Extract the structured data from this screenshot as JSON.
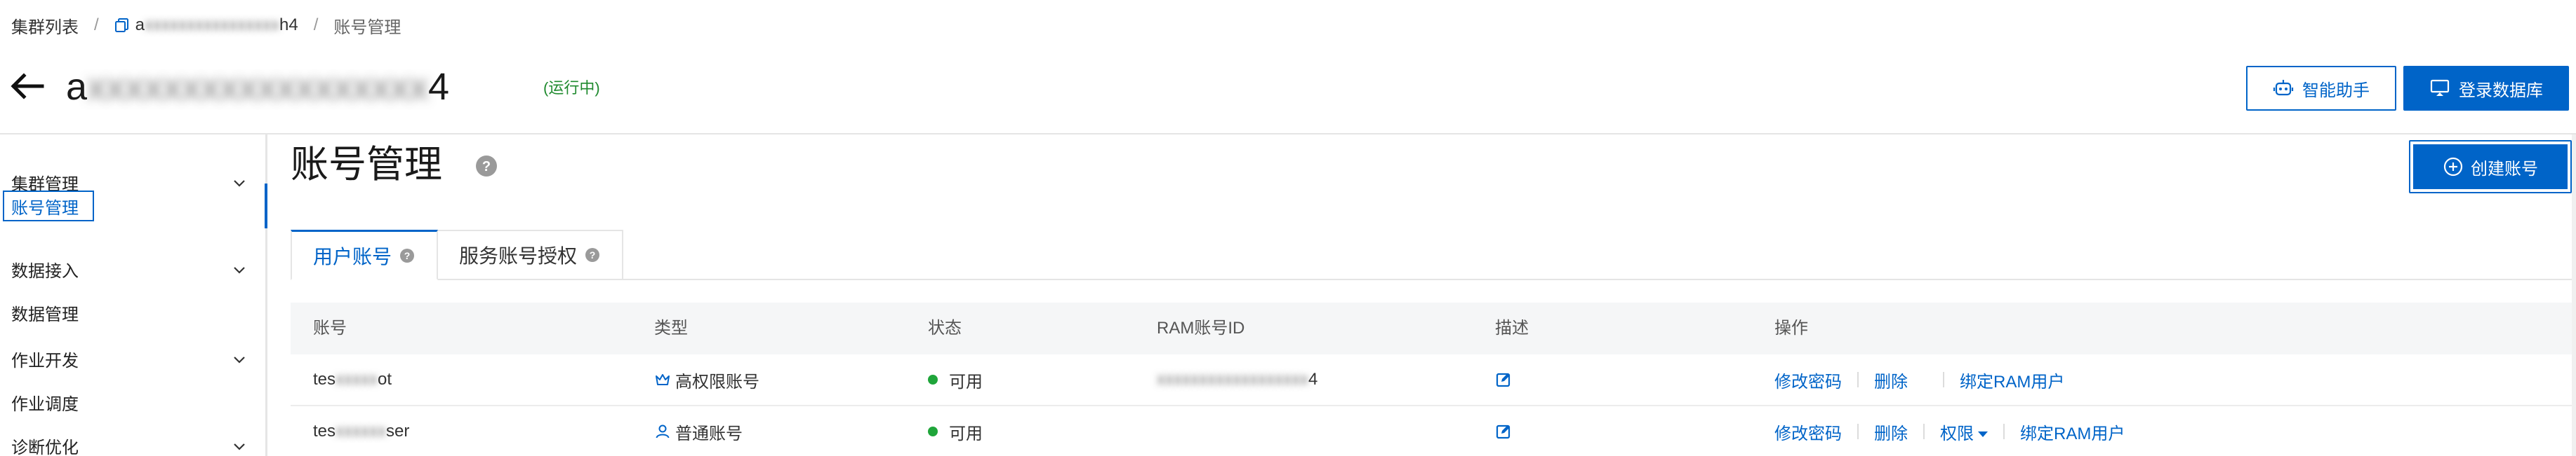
{
  "colors": {
    "accent": "#0064c8",
    "status_running": "#1f8a2e",
    "status_available": "#1fa53a",
    "text": "#333333",
    "header_bg": "#f5f6f7"
  },
  "breadcrumb": {
    "cluster_list": "集群列表",
    "separator": "/",
    "cluster_prefix": "a",
    "cluster_masked": "xxxxxxxxxxxxxxxx",
    "cluster_suffix": "h4",
    "current": "账号管理",
    "cluster_icon": "copy-icon"
  },
  "header": {
    "back_icon": "arrow-left-icon",
    "cluster_prefix": "a",
    "cluster_masked": "xxxxxxxxxxxxxxxxxx",
    "cluster_suffix": "4",
    "status": "(运行中)",
    "assistant_label": "智能助手",
    "assistant_icon": "robot-icon",
    "login_db_label": "登录数据库",
    "login_db_icon": "monitor-icon"
  },
  "sidebar": {
    "items": [
      {
        "label": "集群管理",
        "expandable": true
      },
      {
        "label": "账号管理",
        "active": true
      },
      {
        "label": "数据接入",
        "expandable": true
      },
      {
        "label": "数据管理"
      },
      {
        "label": "作业开发",
        "expandable": true
      },
      {
        "label": "作业调度"
      },
      {
        "label": "诊断优化",
        "expandable": true
      }
    ]
  },
  "main": {
    "title": "账号管理",
    "create_label": "创建账号",
    "tabs": [
      {
        "label": "用户账号",
        "active": true
      },
      {
        "label": "服务账号授权"
      }
    ],
    "table": {
      "columns": [
        "账号",
        "类型",
        "状态",
        "RAM账号ID",
        "描述",
        "操作"
      ],
      "rows": [
        {
          "account_prefix": "tes",
          "account_masked": "xxxxx",
          "account_suffix": "ot",
          "type": "高权限账号",
          "type_icon": "crown-icon",
          "status": "可用",
          "ram_masked": "xxxxxxxxxxxxxxxxxx",
          "ram_suffix": "4",
          "desc_icon": "edit-icon",
          "ops": [
            "修改密码",
            "删除",
            "",
            "绑定RAM用户"
          ]
        },
        {
          "account_prefix": "tes",
          "account_masked": "xxxxxx",
          "account_suffix": "ser",
          "type": "普通账号",
          "type_icon": "user-icon",
          "status": "可用",
          "desc_icon": "edit-icon",
          "ops": [
            "修改密码",
            "删除",
            "权限",
            "绑定RAM用户"
          ]
        }
      ]
    }
  }
}
